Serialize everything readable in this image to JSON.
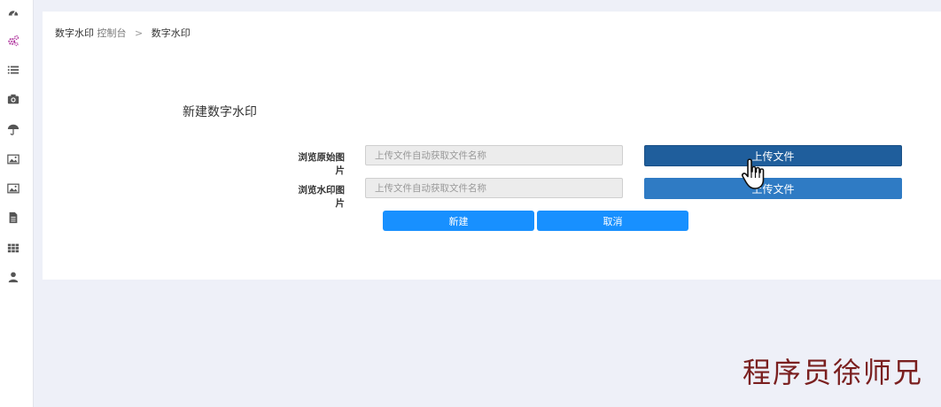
{
  "sidebar": {
    "icons": [
      "dashboard-icon",
      "cogs-icon",
      "list-icon",
      "camera-icon",
      "umbrella-icon",
      "picture-icon",
      "picture-icon-2",
      "document-icon",
      "grid-icon",
      "user-icon"
    ],
    "active_color": "#b23aa0",
    "icon_color": "#555555"
  },
  "breadcrumb": {
    "section": "数字水印",
    "console": "控制台",
    "separator": ">",
    "current": "数字水印"
  },
  "form": {
    "title": "新建数字水印",
    "rows": [
      {
        "label": "浏览原始图片",
        "placeholder": "上传文件自动获取文件名称",
        "upload_label": "上传文件"
      },
      {
        "label": "浏览水印图片",
        "placeholder": "上传文件自动获取文件名称",
        "upload_label": "上传文件"
      }
    ],
    "create_label": "新建",
    "cancel_label": "取消"
  },
  "colors": {
    "primary": "#1890ff",
    "upload_hover": "#1f5e9c",
    "upload": "#2f7bc4",
    "background": "#eef0f8"
  },
  "watermark_text": "程序员徐师兄"
}
